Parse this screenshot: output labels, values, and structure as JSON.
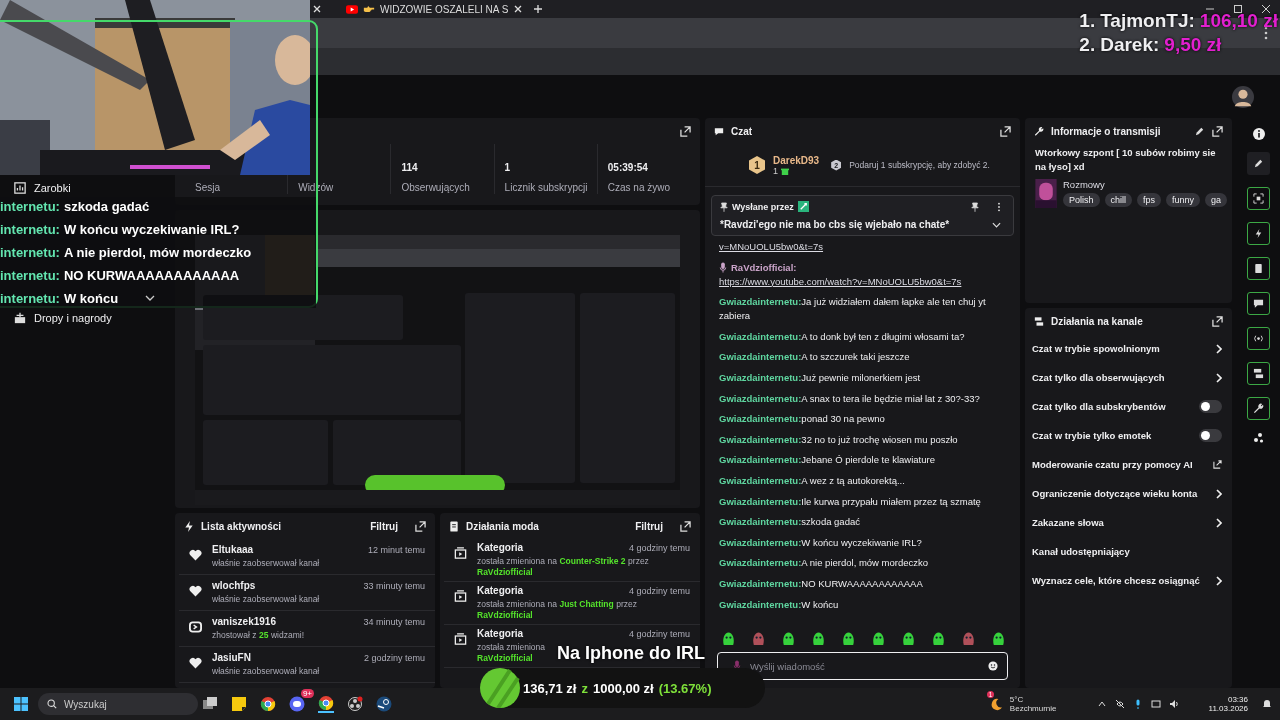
{
  "browser": {
    "tab_title": "WIDZOWIE OSZALELI NA S"
  },
  "sidebar": {
    "items": [
      {
        "label": "Zarobki"
      },
      {
        "label": "Dropy i nagrody"
      }
    ]
  },
  "stats": {
    "cells": [
      {
        "label": "Sesja"
      },
      {
        "label": "Widzów"
      },
      {
        "value": "114",
        "label": "Obserwujących"
      },
      {
        "value": "1",
        "label": "Licznik subskrypcji"
      },
      {
        "value": "05:39:54",
        "label": "Czas na żywo"
      }
    ]
  },
  "activity": {
    "title": "Lista aktywności",
    "filter": "Filtruj",
    "items": [
      {
        "kind": "follow",
        "user": "Eltukaaa",
        "time": "12 minut temu",
        "parts": [
          {
            "text": "właśnie zaobserwował kanał",
            "highlight": false
          }
        ]
      },
      {
        "kind": "follow",
        "user": "wlochfps",
        "time": "33 minuty temu",
        "parts": [
          {
            "text": "właśnie zaobserwował kanał",
            "highlight": false
          }
        ]
      },
      {
        "kind": "host",
        "user": "vaniszek1916",
        "time": "34 minuty temu",
        "parts": [
          {
            "text": "zhostował z",
            "highlight": false
          },
          {
            "text": "25",
            "highlight": true
          },
          {
            "text": "widzami!",
            "highlight": false
          }
        ]
      },
      {
        "kind": "follow",
        "user": "JasiuFN",
        "time": "2 godziny temu",
        "parts": [
          {
            "text": "właśnie zaobserwował kanał",
            "highlight": false
          }
        ]
      }
    ]
  },
  "mod_actions": {
    "title": "Działania moda",
    "filter": "Filtruj",
    "items": [
      {
        "title": "Kategoria",
        "time": "4 godziny temu",
        "parts": [
          {
            "text": "została zmieniona na",
            "highlight": false
          },
          {
            "text": "Counter-Strike 2",
            "highlight": true
          },
          {
            "text": "przez",
            "highlight": false
          },
          {
            "text": "RaVdziofficial",
            "highlight": true
          }
        ]
      },
      {
        "title": "Kategoria",
        "time": "4 godziny temu",
        "parts": [
          {
            "text": "została zmieniona na",
            "highlight": false
          },
          {
            "text": "Just Chatting",
            "highlight": true
          },
          {
            "text": "przez",
            "highlight": false
          },
          {
            "text": "RaVdziofficial",
            "highlight": true
          }
        ]
      },
      {
        "title": "Kategoria",
        "time": "4 godziny temu",
        "parts": [
          {
            "text": "została zmieniona",
            "highlight": false
          },
          {
            "text": "RaVdziofficial",
            "highlight": true
          }
        ]
      }
    ]
  },
  "chat": {
    "title": "Czat",
    "leader": {
      "rank": "1",
      "name": "DarekD93",
      "count": "1",
      "promo_rank": "2",
      "promo": "Podaruj 1 subskrypcję, aby zdobyć 2."
    },
    "pinned": {
      "label": "Wysłane przez",
      "text": "*Ravdzi'ego nie ma bo cbs się wjebało na chate*"
    },
    "messages": [
      {
        "kind": "link_tail",
        "link": "v=MNoUOLU5bw0&t=7s"
      },
      {
        "kind": "link",
        "user": "RaVdziofficial:",
        "color": "#c9a3c8",
        "badge": true,
        "link": "https://www.youtube.com/watch?v=MNoUOLU5bw0&t=7s"
      },
      {
        "kind": "text",
        "user": "Gwiazdainternetu:",
        "color": "#5fd6a0",
        "badge": false,
        "text": "Ja już widziałem dałem łapke ale ten chuj yt zabiera"
      },
      {
        "kind": "text",
        "user": "Gwiazdainternetu:",
        "color": "#5fd6a0",
        "badge": false,
        "text": "A to donk był ten z długimi włosami ta?"
      },
      {
        "kind": "text",
        "user": "Gwiazdainternetu:",
        "color": "#5fd6a0",
        "badge": false,
        "text": "A to szczurek taki jeszcze"
      },
      {
        "kind": "text",
        "user": "Gwiazdainternetu:",
        "color": "#5fd6a0",
        "badge": false,
        "text": "Już pewnie milonerkiem jest"
      },
      {
        "kind": "text",
        "user": "Gwiazdainternetu:",
        "color": "#5fd6a0",
        "badge": false,
        "text": "A snax to tera ile będzie miał lat z 30?-33?"
      },
      {
        "kind": "text",
        "user": "Gwiazdainternetu:",
        "color": "#5fd6a0",
        "badge": false,
        "text": "ponad 30 na pewno"
      },
      {
        "kind": "text",
        "user": "Gwiazdainternetu:",
        "color": "#5fd6a0",
        "badge": false,
        "text": "32 no to już trochę wiosen mu poszło"
      },
      {
        "kind": "text",
        "user": "Gwiazdainternetu:",
        "color": "#5fd6a0",
        "badge": false,
        "text": "Jebane Ó pierdole te klawiature"
      },
      {
        "kind": "text",
        "user": "Gwiazdainternetu:",
        "color": "#5fd6a0",
        "badge": false,
        "text": "A wez z tą autokorektą..."
      },
      {
        "kind": "text",
        "user": "Gwiazdainternetu:",
        "color": "#5fd6a0",
        "badge": false,
        "text": "Ile kurwa przypału miałem przez tą szmatę"
      },
      {
        "kind": "text",
        "user": "Gwiazdainternetu:",
        "color": "#5fd6a0",
        "badge": false,
        "text": "szkoda gadać"
      },
      {
        "kind": "text",
        "user": "Gwiazdainternetu:",
        "color": "#5fd6a0",
        "badge": false,
        "text": "W końcu wyczekiwanie IRL?"
      },
      {
        "kind": "text",
        "user": "Gwiazdainternetu:",
        "color": "#5fd6a0",
        "badge": false,
        "text": "A nie pierdol, mów mordeczko"
      },
      {
        "kind": "text",
        "user": "Gwiazdainternetu:",
        "color": "#5fd6a0",
        "badge": false,
        "text": "NO KURWAAAAAAAAAAAA"
      },
      {
        "kind": "text",
        "user": "Gwiazdainternetu:",
        "color": "#5fd6a0",
        "badge": false,
        "text": "W końcu"
      }
    ],
    "input": {
      "placeholder": "Wyślij wiadomość"
    }
  },
  "stream_info": {
    "title": "Informacje o transmisji",
    "stream_title": "Wtorkowy szpont [ 10 subów robimy sie na łyso] xd",
    "category": "Rozmowy",
    "tags": [
      "Polish",
      "chill",
      "fps",
      "funny",
      "ga"
    ]
  },
  "channel_actions": {
    "title": "Działania na kanale",
    "items": [
      {
        "label": "Czat w trybie spowolnionym",
        "kind": "submenu"
      },
      {
        "label": "Czat tylko dla obserwujących",
        "kind": "submenu"
      },
      {
        "label": "Czat tylko dla subskrybentów",
        "kind": "toggle",
        "on": false
      },
      {
        "label": "Czat w trybie tylko emotek",
        "kind": "toggle",
        "on": false
      },
      {
        "label": "Moderowanie czatu przy pomocy AI",
        "kind": "external"
      },
      {
        "label": "Ograniczenie dotyczące wieku konta",
        "kind": "submenu"
      },
      {
        "label": "Zakazane słowa",
        "kind": "submenu"
      },
      {
        "label": "Kanał udostępniający",
        "kind": "plain"
      },
      {
        "label": "Wyznacz cele, które chcesz osiągnąć",
        "kind": "submenu"
      }
    ]
  },
  "overlay": {
    "leaderboard": [
      {
        "rank": "1.",
        "name": "TajmonTJ:",
        "amount": "106,10 zł"
      },
      {
        "rank": "2.",
        "name": "Darek:",
        "amount": "9,50 zł"
      }
    ],
    "stream_chat": [
      {
        "user": "internetu:",
        "text": "szkoda gadać"
      },
      {
        "user": "internetu:",
        "text": "W końcu wyczekiwanie IRL?"
      },
      {
        "user": "internetu:",
        "text": "A nie pierdol, mów mordeczko"
      },
      {
        "user": "internetu:",
        "text": "NO KURWAAAAAAAAAAAA"
      },
      {
        "user": "internetu:",
        "text": "W końcu"
      }
    ],
    "caption": "Na Iphone do IRL",
    "goal": {
      "current": "136,71 zł",
      "separator": "z",
      "target": "1000,00 zł",
      "percent": "(13.67%)"
    }
  },
  "taskbar": {
    "search_placeholder": "Wyszukaj",
    "app_badge": "9+",
    "weather_alert": "1",
    "temperature": "5°C",
    "weather": "Bezchmurnie",
    "time": "03:36",
    "date": "11.03.2026"
  }
}
